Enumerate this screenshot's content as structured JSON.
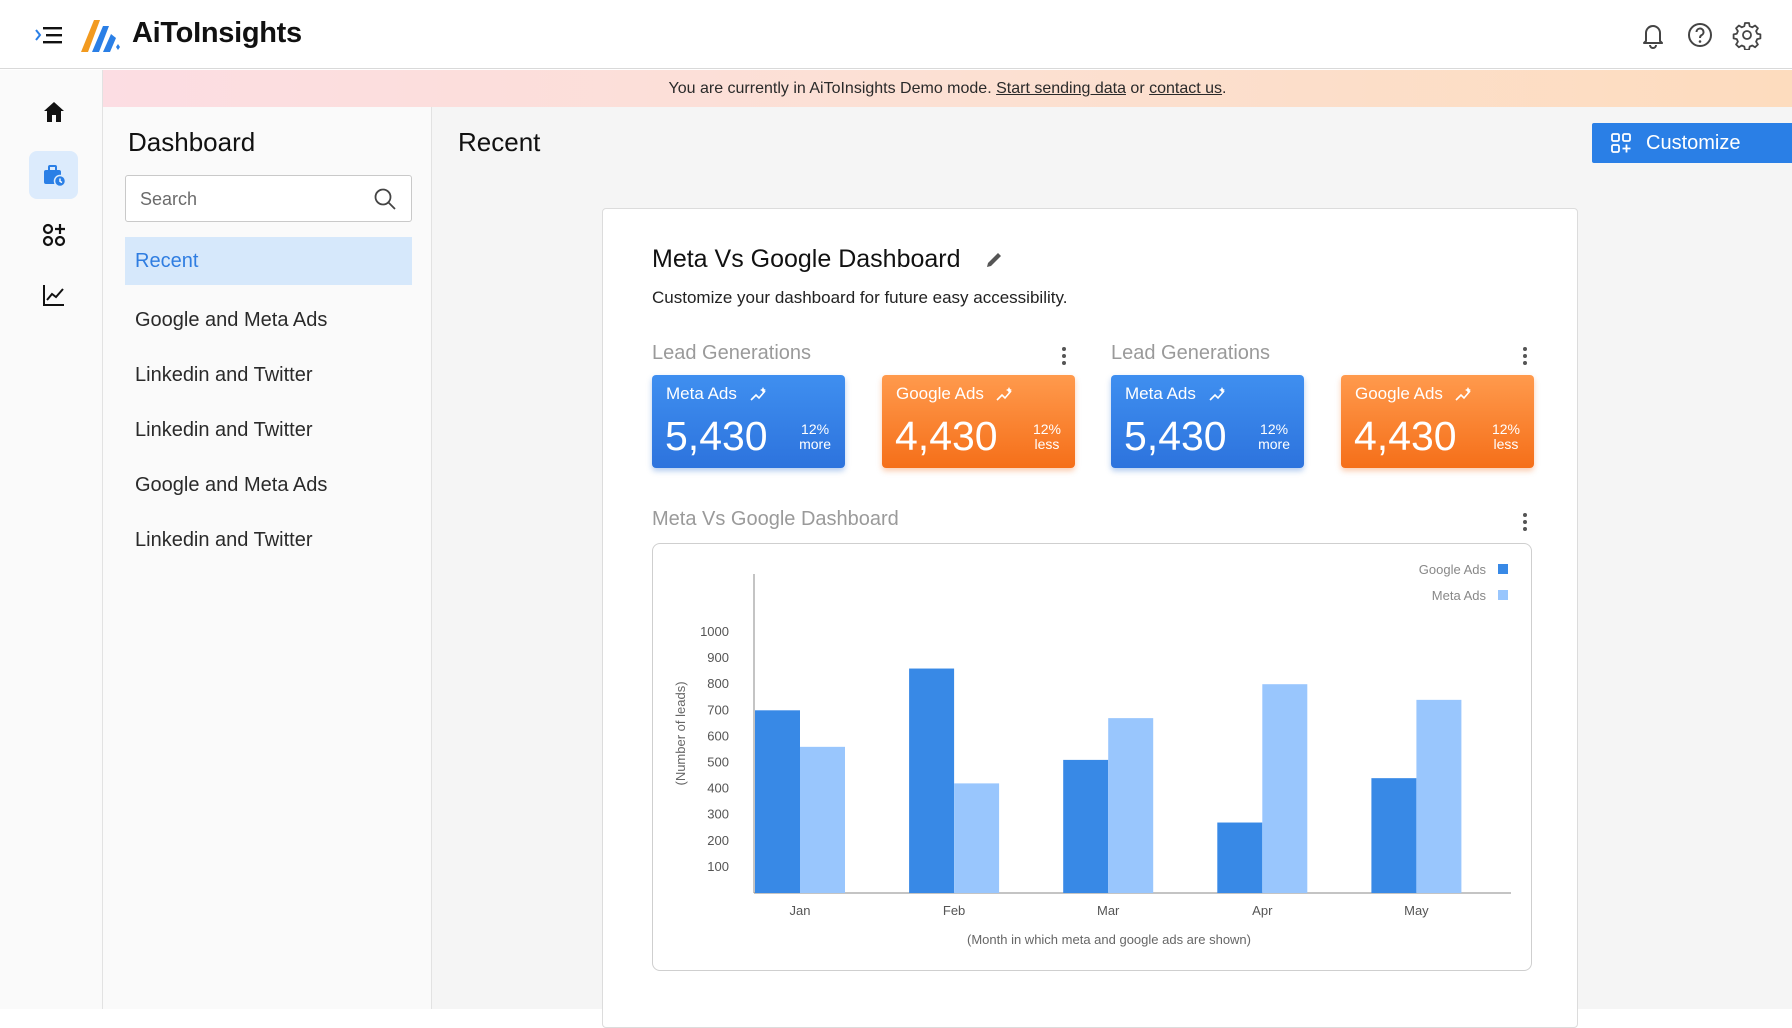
{
  "app": {
    "brand": "AiToInsights",
    "banner": {
      "prefix": "You are currently in AiToInsights Demo mode. ",
      "link1": "Start sending data",
      "middle": " or ",
      "link2": "contact us",
      "suffix": "."
    }
  },
  "topbar_icons": [
    "bell-icon",
    "help-icon",
    "settings-icon"
  ],
  "rail": [
    "home-icon",
    "briefcase-clock-icon",
    "apps-icon",
    "line-chart-icon"
  ],
  "sidebar": {
    "title": "Dashboard",
    "search_placeholder": "Search",
    "items": [
      {
        "label": "Recent",
        "active": true
      },
      {
        "label": "Google and Meta Ads"
      },
      {
        "label": "Linkedin and Twitter"
      },
      {
        "label": "Linkedin and Twitter"
      },
      {
        "label": "Google and Meta Ads"
      },
      {
        "label": "Linkedin and Twitter"
      }
    ]
  },
  "main": {
    "title": "Recent",
    "customize_label": "Customize",
    "card": {
      "title": "Meta Vs Google Dashboard",
      "subtitle": "Customize your dashboard for future easy accessibility.",
      "widgets": [
        {
          "label": "Lead Generations",
          "stats": [
            {
              "name": "Meta Ads",
              "value": "5,430",
              "pct": "12%",
              "dir": "more",
              "color": "blue"
            },
            {
              "name": "Google Ads",
              "value": "4,430",
              "pct": "12%",
              "dir": "less",
              "color": "orange"
            }
          ]
        },
        {
          "label": "Lead Generations",
          "stats": [
            {
              "name": "Meta Ads",
              "value": "5,430",
              "pct": "12%",
              "dir": "more",
              "color": "blue"
            },
            {
              "name": "Google Ads",
              "value": "4,430",
              "pct": "12%",
              "dir": "less",
              "color": "orange"
            }
          ]
        }
      ],
      "chart_label": "Meta Vs Google Dashboard"
    }
  },
  "chart_data": {
    "type": "bar",
    "title": "",
    "categories": [
      "Jan",
      "Feb",
      "Mar",
      "Apr",
      "May"
    ],
    "series": [
      {
        "name": "Google Ads",
        "color": "#3889e6",
        "values": [
          700,
          860,
          510,
          270,
          440
        ]
      },
      {
        "name": "Meta Ads",
        "color": "#99c6fd",
        "values": [
          560,
          420,
          670,
          800,
          740
        ]
      }
    ],
    "xlabel": "(Month in which meta and google ads are shown)",
    "ylabel": "(Number of leads)",
    "yticks": [
      100,
      200,
      300,
      400,
      500,
      600,
      700,
      800,
      900,
      1000
    ],
    "ylim": [
      0,
      1000
    ],
    "legend": "top-right",
    "grid": false
  },
  "colors": {
    "accent": "#2a7fe6",
    "active_bg": "#d6e8fb",
    "blue_card": "#3182e4",
    "orange_card": "#f77b26"
  }
}
